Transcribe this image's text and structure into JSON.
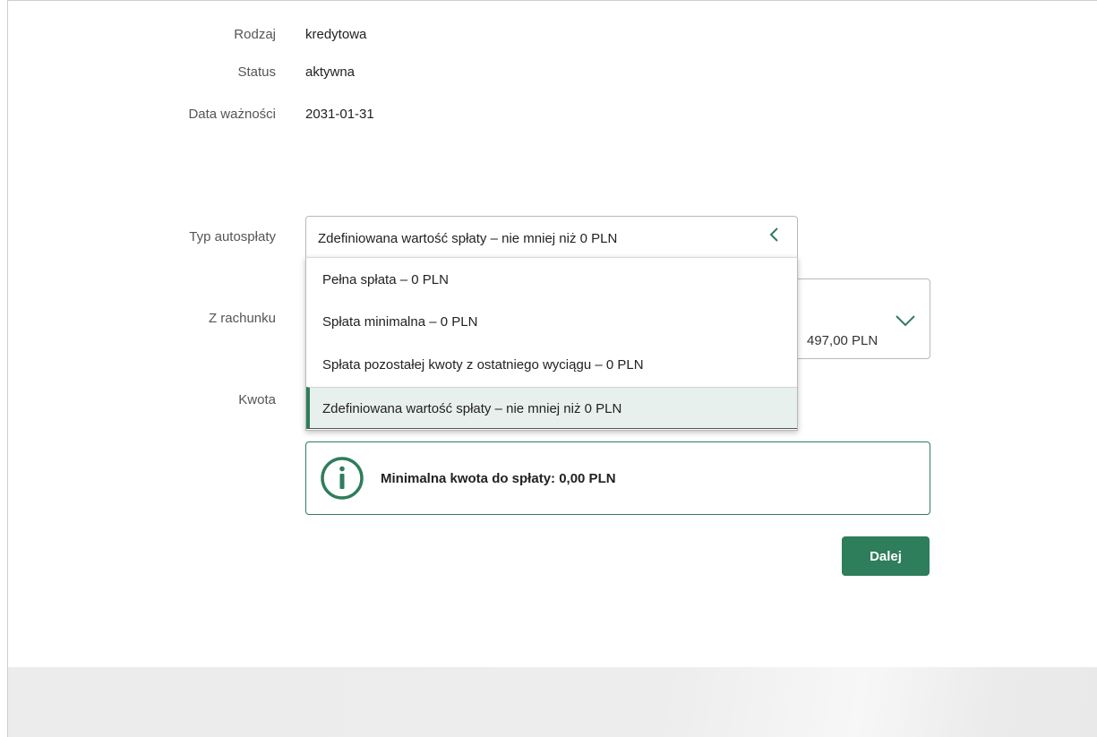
{
  "details": {
    "type_label": "Rodzaj",
    "type_value": "kredytowa",
    "status_label": "Status",
    "status_value": "aktywna",
    "expiry_label": "Data ważności",
    "expiry_value": "2031-01-31"
  },
  "form": {
    "autopay_type_label": "Typ autospłaty",
    "autopay_type_selected": "Zdefiniowana wartość spłaty – nie mniej niż 0 PLN",
    "autopay_options": [
      "Pełna spłata – 0 PLN",
      "Spłata minimalna – 0 PLN",
      "Spłata pozostałej kwoty z ostatniego wyciągu – 0 PLN",
      "Zdefiniowana wartość spłaty – nie mniej niż 0 PLN"
    ],
    "from_account_label": "Z rachunku",
    "from_account_balance_partial": "497,00 PLN",
    "amount_label": "Kwota"
  },
  "info": {
    "message": "Minimalna kwota do spłaty: 0,00 PLN",
    "icon": "info-icon"
  },
  "actions": {
    "next_label": "Dalej"
  },
  "colors": {
    "accent": "#2e7d5b",
    "selected_option_bg": "#e8f0ee",
    "footer_bg": "#ececec"
  }
}
